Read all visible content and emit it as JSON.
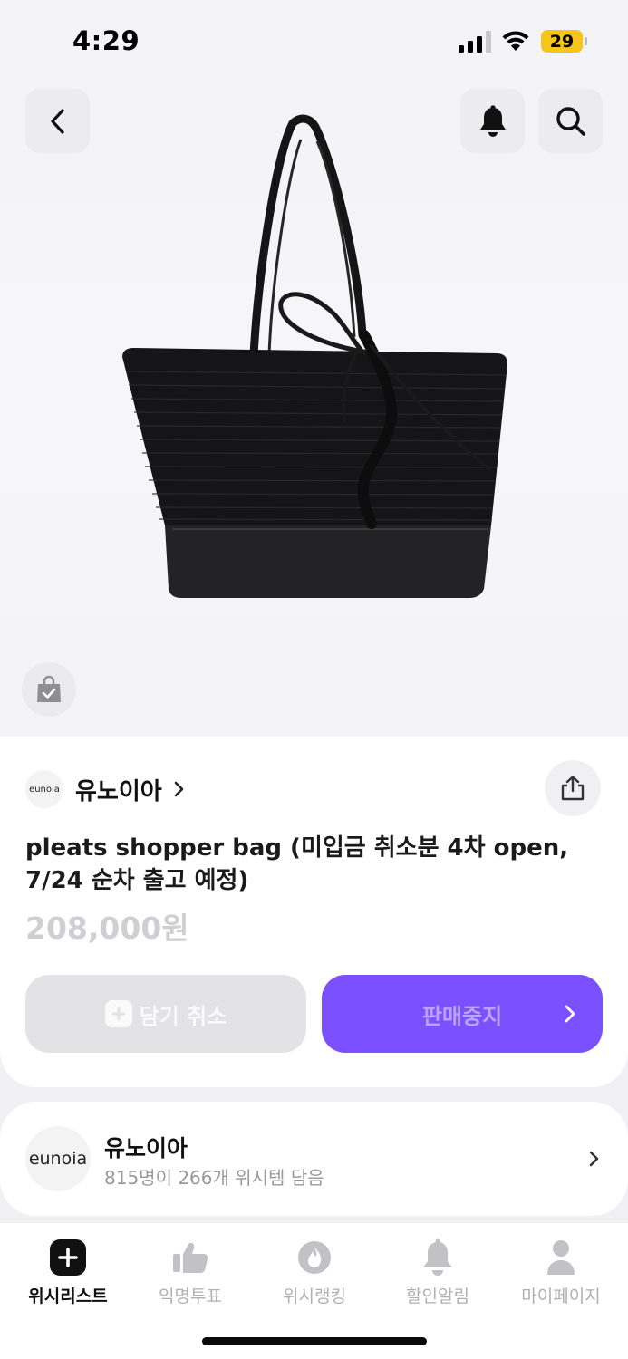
{
  "status_bar": {
    "time": "4:29",
    "battery": "29"
  },
  "brand": {
    "logo_text": "eunoia",
    "name": "유노이아"
  },
  "product": {
    "title": "pleats shopper bag (미입금 취소분 4차 open, 7/24 순차 출고 예정)",
    "price": "208,000원"
  },
  "actions": {
    "cancel_label": "담기 취소",
    "sold_label": "판매중지"
  },
  "brand_card": {
    "logo_text": "eunoia",
    "name": "유노이아",
    "stats": "815명이 266개 위시템 담음"
  },
  "nav": {
    "items": [
      {
        "label": "위시리스트",
        "icon": "plus-icon",
        "active": true
      },
      {
        "label": "익명투표",
        "icon": "thumbs-up-icon"
      },
      {
        "label": "위시랭킹",
        "icon": "flame-icon"
      },
      {
        "label": "할인알림",
        "icon": "bell-icon"
      },
      {
        "label": "마이페이지",
        "icon": "person-icon"
      }
    ]
  },
  "colors": {
    "accent": "#7a50ff",
    "battery": "#f5c518"
  }
}
